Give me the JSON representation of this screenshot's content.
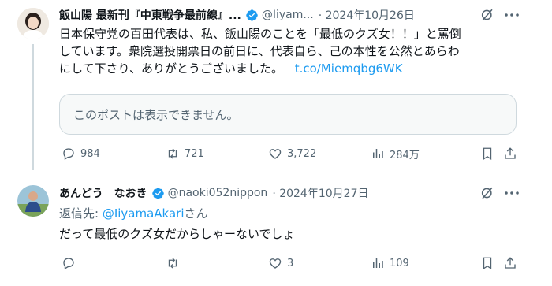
{
  "tweet1": {
    "name": "飯山陽 最新刊『中東戦争最前線』...",
    "handle": "@Iiyam...",
    "date": "· 2024年10月26日",
    "text_lines": [
      "日本保守党の百田代表は、私、飯山陽のことを「最低のクズ女！！」と罵倒",
      "しています。衆院選投開票日の前日に、代表自ら、己の本性を公然とあらわ",
      "にして下さり、ありがとうございました。"
    ],
    "link": "t.co/Miemqbg6WK",
    "quote_unavailable": "このポストは表示できません。",
    "stats": {
      "replies": "984",
      "reposts": "721",
      "likes": "3,722",
      "views": "284万"
    }
  },
  "tweet2": {
    "name": "あんどう　なおき",
    "handle": "@naoki052nippon",
    "date": "· 2024年10月27日",
    "reply_prefix": "返信先: ",
    "reply_to": "@IiyamaAkari",
    "reply_suffix": "さん",
    "text": "だって最低のクズ女だからしゃーないでしょ",
    "stats": {
      "replies": "",
      "reposts": "",
      "likes": "3",
      "views": "109"
    }
  },
  "colors": {
    "verified": "#1d9bf0",
    "link": "#1d9bf0",
    "muted": "#536471"
  }
}
